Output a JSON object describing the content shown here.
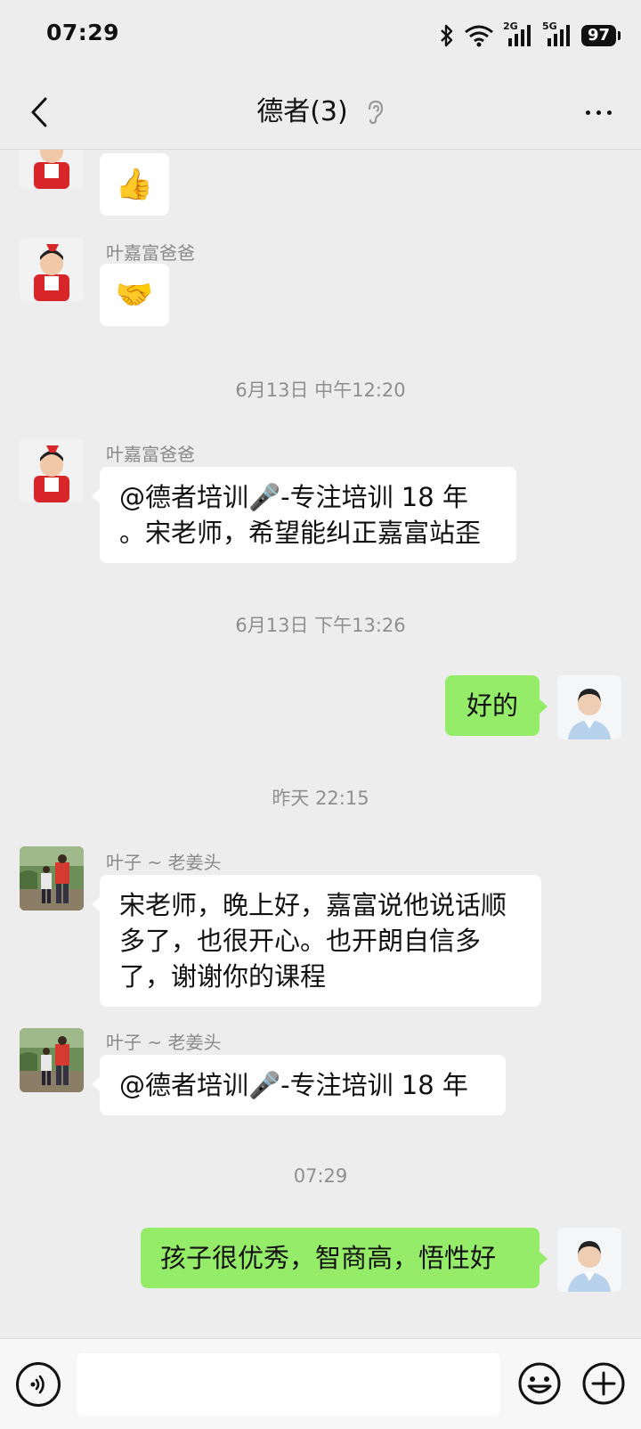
{
  "status_bar": {
    "time": "07:29",
    "battery": "97",
    "network_1": "2G",
    "network_2": "5G"
  },
  "header": {
    "title": "德者(3)",
    "back_icon": "chevron-left-icon",
    "listen_icon": "ear-icon",
    "more_icon": "more-dots-icon"
  },
  "messages": [
    {
      "type": "emoji",
      "side": "left",
      "sender": "",
      "content": "👍"
    },
    {
      "type": "emoji",
      "side": "left",
      "sender": "叶嘉富爸爸",
      "content": "🤝"
    },
    {
      "type": "timestamp",
      "content": "6月13日 中午12:20"
    },
    {
      "type": "text",
      "side": "left",
      "sender": "叶嘉富爸爸",
      "content": "@德者培训🎤-专注培训 18 年 。宋老师，希望能纠正嘉富站歪"
    },
    {
      "type": "timestamp",
      "content": "6月13日 下午13:26"
    },
    {
      "type": "text",
      "side": "right",
      "content": "好的"
    },
    {
      "type": "timestamp",
      "content": "昨天 22:15"
    },
    {
      "type": "text",
      "side": "left",
      "sender": "叶子 ~ 老姜头",
      "content": "宋老师，晚上好，嘉富说他说话顺多了，也很开心。也开朗自信多了，谢谢你的课程"
    },
    {
      "type": "text",
      "side": "left",
      "sender": "叶子 ~ 老姜头",
      "content": "@德者培训🎤-专注培训 18 年"
    },
    {
      "type": "timestamp",
      "content": "07:29"
    },
    {
      "type": "text",
      "side": "right",
      "content": "孩子很优秀，智商高，悟性好"
    }
  ],
  "input_bar": {
    "voice_icon": "voice-icon",
    "emoji_icon": "emoji-icon",
    "plus_icon": "plus-icon",
    "placeholder": ""
  }
}
